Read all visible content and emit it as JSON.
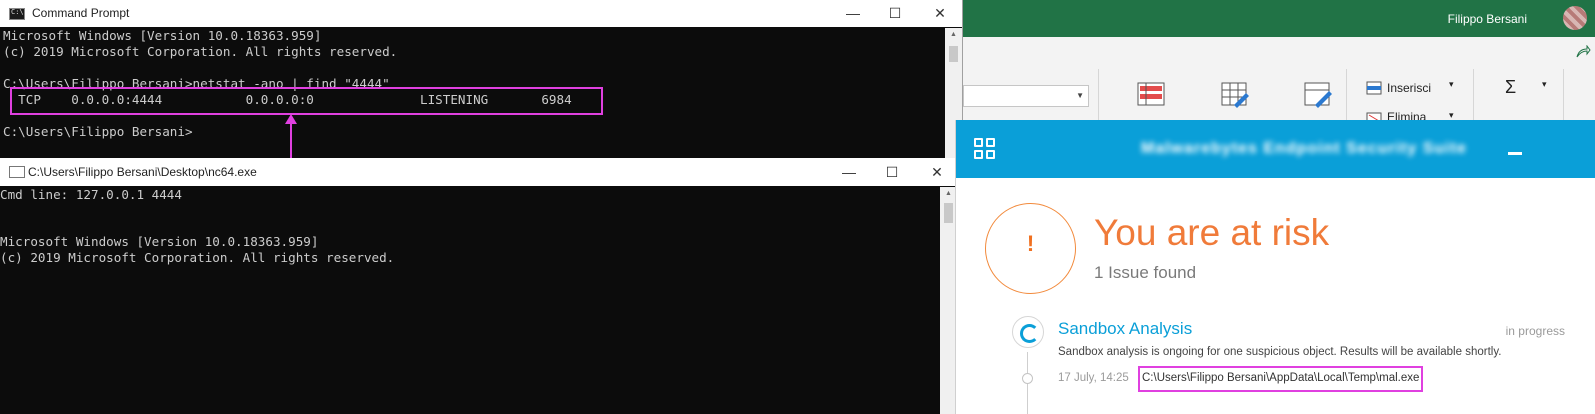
{
  "excel": {
    "user_name": "Filippo Bersani",
    "ribbon": {
      "insert_label": "Inserisci",
      "delete_label": "Elimina",
      "sum_symbol": "Σ"
    },
    "colors": {
      "titlebar": "#217346"
    }
  },
  "cmd_window": {
    "title": "Command Prompt",
    "lines": [
      "Microsoft Windows [Version 10.0.18363.959]",
      "(c) 2019 Microsoft Corporation. All rights reserved.",
      "",
      "C:\\Users\\Filippo Bersani>netstat -ano | find \"4444\"",
      "  TCP    0.0.0.0:4444           0.0.0.0:0              LISTENING       6984",
      "",
      "C:\\Users\\Filippo Bersani>"
    ],
    "controls": {
      "minimize": "—",
      "maximize": "☐",
      "close": "✕"
    }
  },
  "nc_window": {
    "title": "C:\\Users\\Filippo Bersani\\Desktop\\nc64.exe",
    "lines": [
      "Cmd line: 127.0.0.1 4444",
      "",
      "",
      "Microsoft Windows [Version 10.0.18363.959]",
      "(c) 2019 Microsoft Corporation. All rights reserved."
    ],
    "controls": {
      "minimize": "—",
      "maximize": "☐",
      "close": "✕"
    }
  },
  "security": {
    "header_title": "Malwarebytes Endpoint Security Suite",
    "risk_symbol": "!",
    "risk_title": "You are at risk",
    "risk_subtitle": "1 Issue found",
    "event": {
      "title": "Sandbox Analysis",
      "status": "in progress",
      "description": "Sandbox analysis is ongoing for one suspicious object. Results will be available shortly.",
      "date": "17 July, 14:25",
      "path": "C:\\Users\\Filippo Bersani\\AppData\\Local\\Temp\\mal.exe"
    },
    "colors": {
      "header": "#0a9fd8",
      "risk": "#f07b3a",
      "highlight": "#e040e0"
    }
  }
}
